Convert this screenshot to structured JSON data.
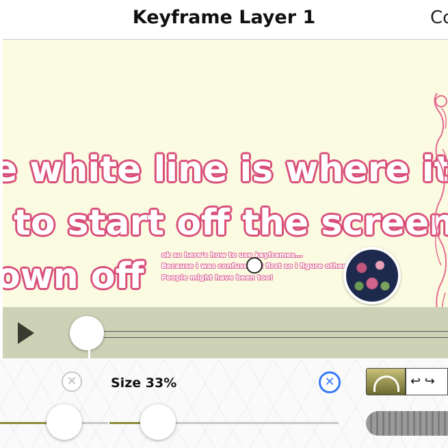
{
  "header": {
    "title": "Keyframe Layer 1",
    "corner_text": "Co"
  },
  "canvas": {
    "big_lines": [
      "e white line is where it st",
      "to start off the screen s",
      "own off"
    ],
    "small_lines": [
      "ok so here's how to use keyframes...",
      "Because i was confused at first so i figure other",
      "People might have been too!"
    ]
  },
  "timeline": {
    "play_icon": "play-icon"
  },
  "controls": {
    "size_label": "Size 33%",
    "clear_icon_left": "close-icon",
    "clear_icon_right": "close-icon",
    "undo_redo": "↩ ↪"
  },
  "colors": {
    "canvas_bg": "#fbfbe2",
    "timeline_bg": "#cdd2b7",
    "text_outline": "#d94f7a",
    "accent_blue": "#3478f6",
    "slider_fill": "#8a8a3a"
  }
}
